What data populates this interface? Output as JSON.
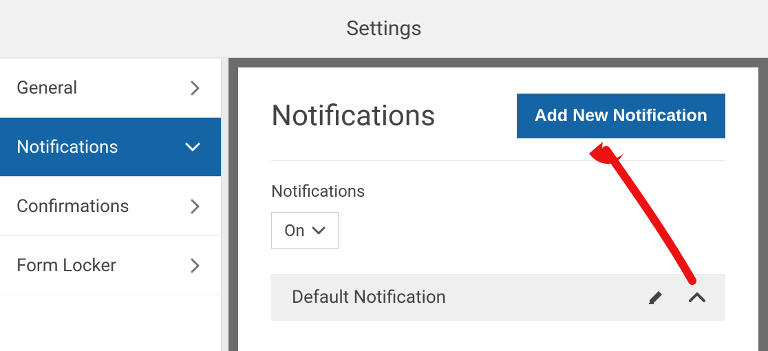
{
  "header": {
    "title": "Settings"
  },
  "sidebar": {
    "items": [
      {
        "label": "General"
      },
      {
        "label": "Notifications"
      },
      {
        "label": "Confirmations"
      },
      {
        "label": "Form Locker"
      }
    ]
  },
  "panel": {
    "title": "Notifications",
    "add_button": "Add New Notification",
    "dropdown_label": "Notifications",
    "dropdown_value": "On"
  },
  "notification_item": {
    "title": "Default Notification"
  }
}
